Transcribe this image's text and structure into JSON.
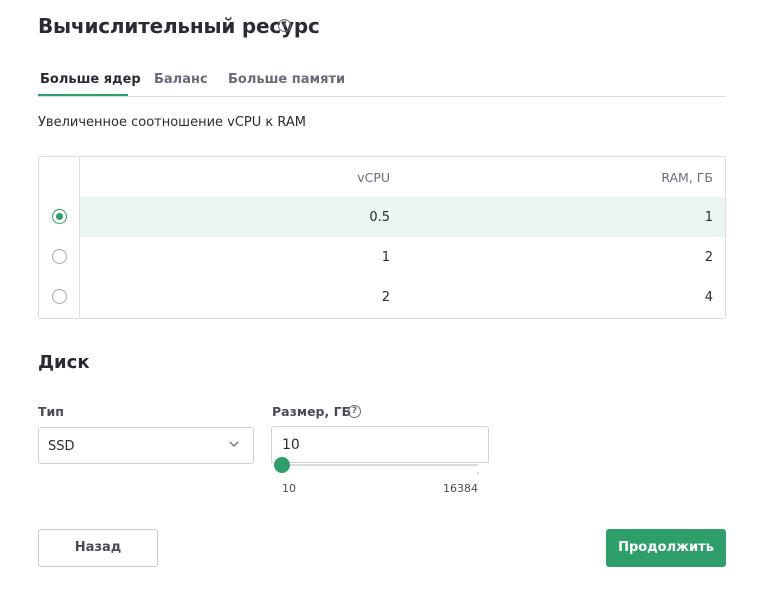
{
  "compute": {
    "title": "Вычислительный ресурс",
    "help_icon": "?",
    "tabs": [
      {
        "label": "Больше ядер",
        "active": true
      },
      {
        "label": "Баланс",
        "active": false
      },
      {
        "label": "Больше памяти",
        "active": false
      }
    ],
    "subtitle": "Увеличенное соотношение vCPU к RAM",
    "table": {
      "columns": [
        "vCPU",
        "RAM, ГБ"
      ],
      "rows": [
        {
          "vcpu": "0.5",
          "ram": "1",
          "selected": true
        },
        {
          "vcpu": "1",
          "ram": "2",
          "selected": false
        },
        {
          "vcpu": "2",
          "ram": "4",
          "selected": false
        }
      ]
    }
  },
  "disk": {
    "title": "Диск",
    "type_label": "Тип",
    "type_value": "SSD",
    "size_label": "Размер, ГБ",
    "size_help_icon": "?",
    "size_value": "10",
    "slider": {
      "min": "10",
      "max": "16384",
      "value": 10
    }
  },
  "footer": {
    "back_label": "Назад",
    "next_label": "Продолжить"
  },
  "colors": {
    "accent": "#2e9e6a",
    "selected_row": "#e9f5ee"
  }
}
